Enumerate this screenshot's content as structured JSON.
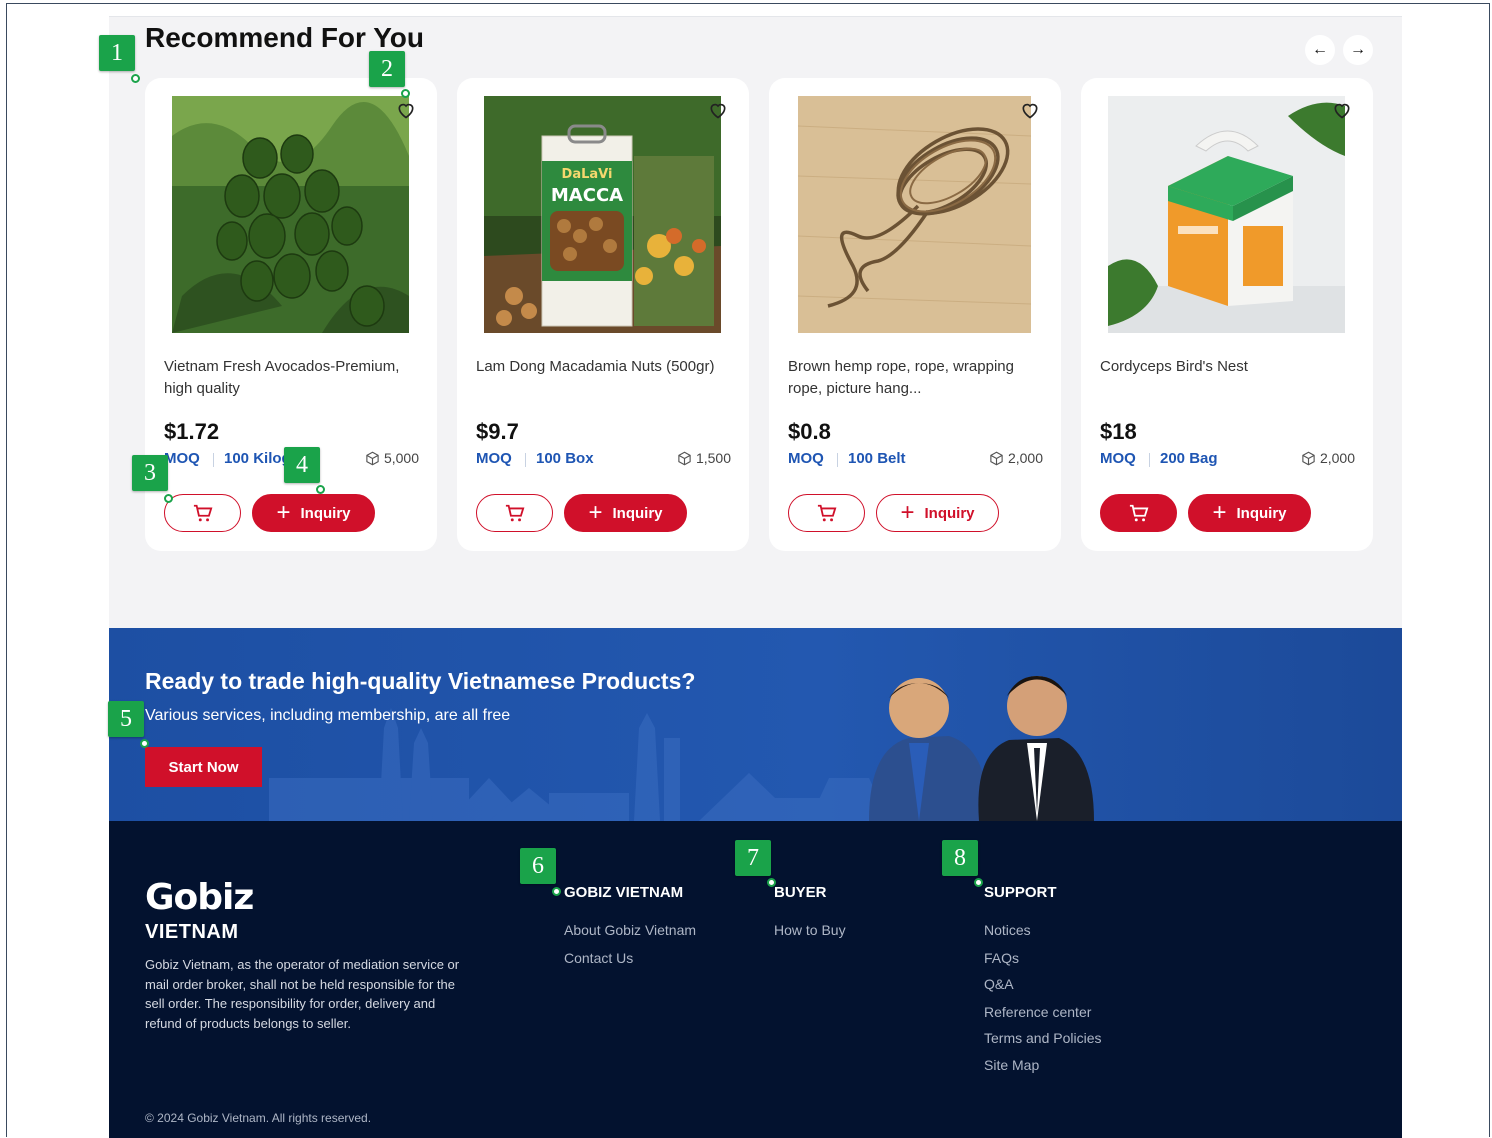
{
  "recommend": {
    "title": "Recommend For You",
    "prev_icon": "arrow-left-icon",
    "next_icon": "arrow-right-icon",
    "prev_glyph": "←",
    "next_glyph": "→"
  },
  "products": [
    {
      "name": "Vietnam Fresh Avocados-Premium, high quality",
      "price": "$1.72",
      "moq_label": "MOQ",
      "moq_value": "100 Kilogram",
      "stock": "5,000",
      "inquiry_label": "Inquiry",
      "cart_style": "outline",
      "inquiry_style": "filled",
      "image": "avocado-photo"
    },
    {
      "name": "Lam Dong Macadamia Nuts (500gr)",
      "price": "$9.7",
      "moq_label": "MOQ",
      "moq_value": "100 Box",
      "stock": "1,500",
      "inquiry_label": "Inquiry",
      "cart_style": "outline",
      "inquiry_style": "filled",
      "image": "macadamia-photo",
      "img_text_brand": "DaLaVi",
      "img_text_product": "MACCA"
    },
    {
      "name": "Brown hemp rope, rope, wrapping rope, picture hang...",
      "price": "$0.8",
      "moq_label": "MOQ",
      "moq_value": "100 Belt",
      "stock": "2,000",
      "inquiry_label": "Inquiry",
      "cart_style": "outline",
      "inquiry_style": "outline",
      "image": "hemp-rope-photo"
    },
    {
      "name": "Cordyceps Bird's Nest",
      "price": "$18",
      "moq_label": "MOQ",
      "moq_value": "200 Bag",
      "stock": "2,000",
      "inquiry_label": "Inquiry",
      "cart_style": "filled",
      "inquiry_style": "filled",
      "image": "birds-nest-box-photo"
    }
  ],
  "banner": {
    "title": "Ready to trade high-quality Vietnamese Products?",
    "subtitle": "Various services, including membership, are all free",
    "cta_label": "Start Now"
  },
  "footer": {
    "logo_main": "Gobiz",
    "logo_sub": "VIETNAM",
    "description": "Gobiz Vietnam, as the operator of mediation service or mail order broker, shall not be held responsible for the sell order. The responsibility for order, delivery and refund of products belongs to seller.",
    "columns": [
      {
        "heading": "GOBIZ VIETNAM",
        "links": [
          "About Gobiz Vietnam",
          "Contact Us"
        ]
      },
      {
        "heading": "BUYER",
        "links": [
          "How to Buy"
        ]
      },
      {
        "heading": "SUPPORT",
        "links": [
          "Notices",
          "FAQs",
          "Q&A",
          "Reference center",
          "Terms and Policies",
          "Site Map"
        ]
      }
    ],
    "copyright": "© 2024 Gobiz Vietnam. All rights reserved."
  },
  "annotations": [
    "1",
    "2",
    "3",
    "4",
    "5",
    "6",
    "7",
    "8"
  ],
  "colors": {
    "accent_red": "#d0102a",
    "link_blue": "#1e55b3",
    "banner_blue": "#1d4fa3",
    "footer_navy": "#03122f",
    "annotation_green": "#1aa34a"
  }
}
